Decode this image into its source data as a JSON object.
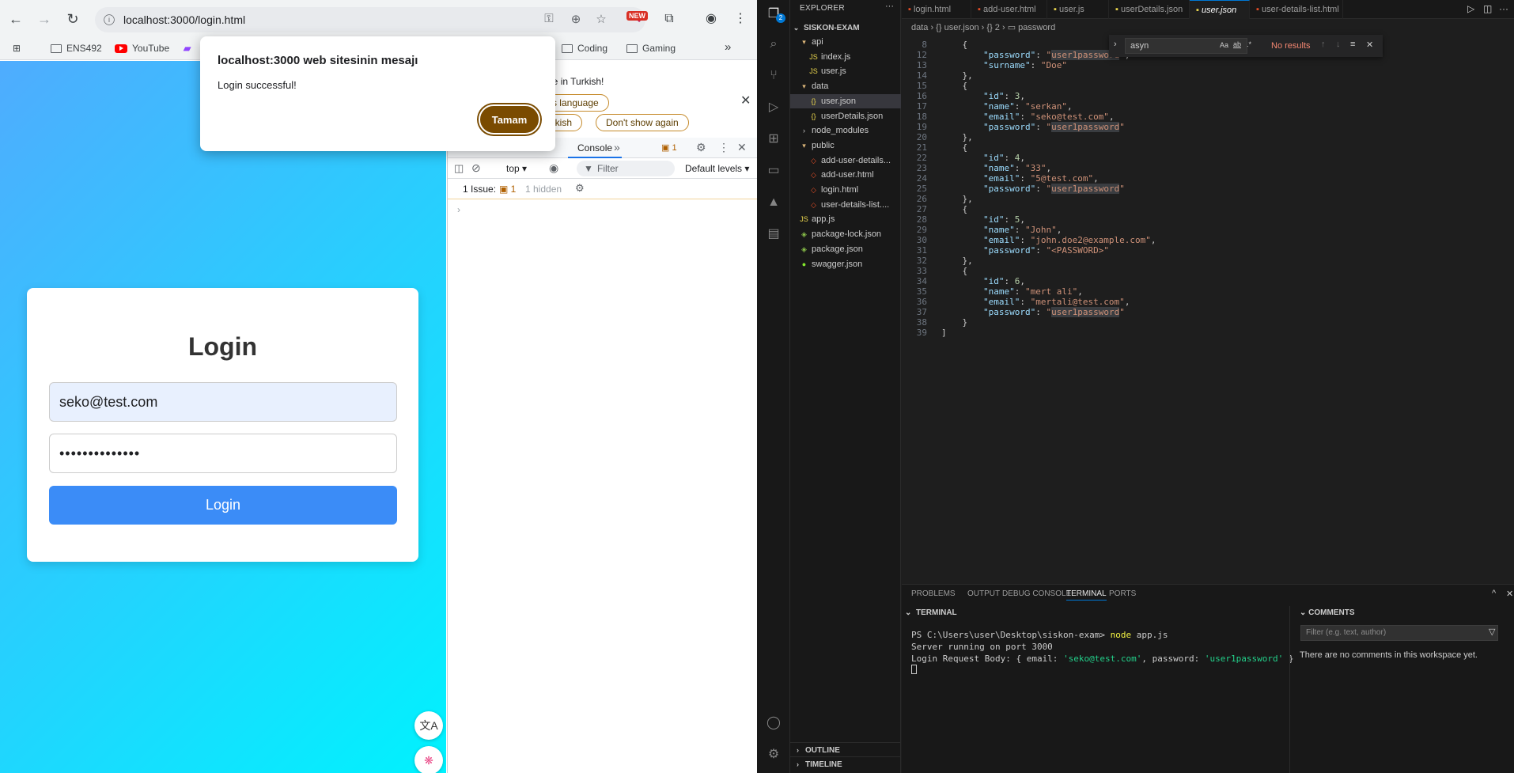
{
  "browser": {
    "url": "localhost:3000/login.html",
    "new_badge": "NEW",
    "bookmarks": [
      {
        "label": "ENS492",
        "type": "folder"
      },
      {
        "label": "YouTube",
        "type": "youtube"
      },
      {
        "label": "Coding",
        "type": "folder"
      },
      {
        "label": "Gaming",
        "type": "folder"
      }
    ]
  },
  "page": {
    "title": "Login",
    "email_value": "seko@test.com",
    "password_value": "••••••••••••••",
    "login_button": "Login"
  },
  "alert": {
    "title": "localhost:3000 web sitesinin mesajı",
    "message": "Login successful!",
    "ok_button": "Tamam"
  },
  "devtools": {
    "translate_text": "lable in Turkish!",
    "translate_btn_language": "e's language",
    "translate_btn_turkish": "urkish",
    "translate_btn_dont_show": "Don't show again",
    "tab_console": "Console",
    "issues_tab_count": "1",
    "context": "top",
    "filter_placeholder": "Filter",
    "levels": "Default levels",
    "issues_label": "1 Issue:",
    "issues_count": "1",
    "hidden": "1 hidden"
  },
  "vscode": {
    "explorer_title": "EXPLORER",
    "project": "SISKON-EXAM",
    "tree": [
      {
        "label": "api",
        "kind": "folder-open",
        "depth": 1
      },
      {
        "label": "index.js",
        "kind": "js",
        "depth": 2
      },
      {
        "label": "user.js",
        "kind": "js",
        "depth": 2
      },
      {
        "label": "data",
        "kind": "folder-open",
        "depth": 1
      },
      {
        "label": "user.json",
        "kind": "json",
        "depth": 2,
        "selected": true
      },
      {
        "label": "userDetails.json",
        "kind": "json",
        "depth": 2
      },
      {
        "label": "node_modules",
        "kind": "folder",
        "depth": 1
      },
      {
        "label": "public",
        "kind": "folder-open",
        "depth": 1
      },
      {
        "label": "add-user-details...",
        "kind": "html",
        "depth": 2
      },
      {
        "label": "add-user.html",
        "kind": "html",
        "depth": 2
      },
      {
        "label": "login.html",
        "kind": "html",
        "depth": 2
      },
      {
        "label": "user-details-list....",
        "kind": "html",
        "depth": 2
      },
      {
        "label": "app.js",
        "kind": "js",
        "depth": 1
      },
      {
        "label": "package-lock.json",
        "kind": "pkg",
        "depth": 1
      },
      {
        "label": "package.json",
        "kind": "pkg",
        "depth": 1
      },
      {
        "label": "swagger.json",
        "kind": "swagger",
        "depth": 1
      }
    ],
    "outline": "OUTLINE",
    "timeline": "TIMELINE",
    "tabs": [
      {
        "label": "login.html",
        "color": "#e44d26"
      },
      {
        "label": "add-user.html",
        "color": "#e44d26"
      },
      {
        "label": "user.js",
        "color": "#e8d44d"
      },
      {
        "label": "userDetails.json",
        "color": "#e8d44d"
      },
      {
        "label": "user.json",
        "color": "#e8d44d",
        "active": true
      },
      {
        "label": "user-details-list.html",
        "color": "#e44d26"
      }
    ],
    "breadcrumb": "data  ›  {} user.json  ›  {} 2  ›  ▭ password",
    "find": {
      "query": "asyn",
      "result": "No results"
    },
    "code_lines": [
      {
        "n": "8",
        "t": "    {"
      },
      {
        "n": "12",
        "t": "        \"password\": \"user1password\","
      },
      {
        "n": "13",
        "t": "        \"surname\": \"Doe\""
      },
      {
        "n": "14",
        "t": "    },"
      },
      {
        "n": "15",
        "t": "    {"
      },
      {
        "n": "16",
        "t": "        \"id\": 3,"
      },
      {
        "n": "17",
        "t": "        \"name\": \"serkan\","
      },
      {
        "n": "18",
        "t": "        \"email\": \"seko@test.com\","
      },
      {
        "n": "19",
        "t": "        \"password\": \"user1password\""
      },
      {
        "n": "20",
        "t": "    },"
      },
      {
        "n": "21",
        "t": "    {"
      },
      {
        "n": "22",
        "t": "        \"id\": 4,"
      },
      {
        "n": "23",
        "t": "        \"name\": \"33\","
      },
      {
        "n": "24",
        "t": "        \"email\": \"5@test.com\","
      },
      {
        "n": "25",
        "t": "        \"password\": \"user1password\""
      },
      {
        "n": "26",
        "t": "    },"
      },
      {
        "n": "27",
        "t": "    {"
      },
      {
        "n": "28",
        "t": "        \"id\": 5,"
      },
      {
        "n": "29",
        "t": "        \"name\": \"John\","
      },
      {
        "n": "30",
        "t": "        \"email\": \"john.doe2@example.com\","
      },
      {
        "n": "31",
        "t": "        \"password\": \"<PASSWORD>\""
      },
      {
        "n": "32",
        "t": "    },"
      },
      {
        "n": "33",
        "t": "    {"
      },
      {
        "n": "34",
        "t": "        \"id\": 6,"
      },
      {
        "n": "35",
        "t": "        \"name\": \"mert ali\","
      },
      {
        "n": "36",
        "t": "        \"email\": \"mertali@test.com\","
      },
      {
        "n": "37",
        "t": "        \"password\": \"user1password\""
      },
      {
        "n": "38",
        "t": "    }"
      },
      {
        "n": "39",
        "t": "]"
      }
    ],
    "panel_tabs": [
      "PROBLEMS",
      "OUTPUT",
      "DEBUG CONSOLE",
      "TERMINAL",
      "PORTS"
    ],
    "terminal_header": "TERMINAL",
    "terminal": {
      "prompt": "PS C:\\Users\\user\\Desktop\\siskon-exam>",
      "cmd_node": "node",
      "cmd_arg": "app.js",
      "line2": "Server running on port 3000",
      "line3_a": "Login Request Body: { email: ",
      "line3_email": "'seko@test.com'",
      "line3_b": ", password: ",
      "line3_pw": "'user1password'",
      "line3_c": " }"
    },
    "comments_header": "COMMENTS",
    "comments_filter": "Filter (e.g. text, author)",
    "comments_empty": "There are no comments in this workspace yet."
  }
}
